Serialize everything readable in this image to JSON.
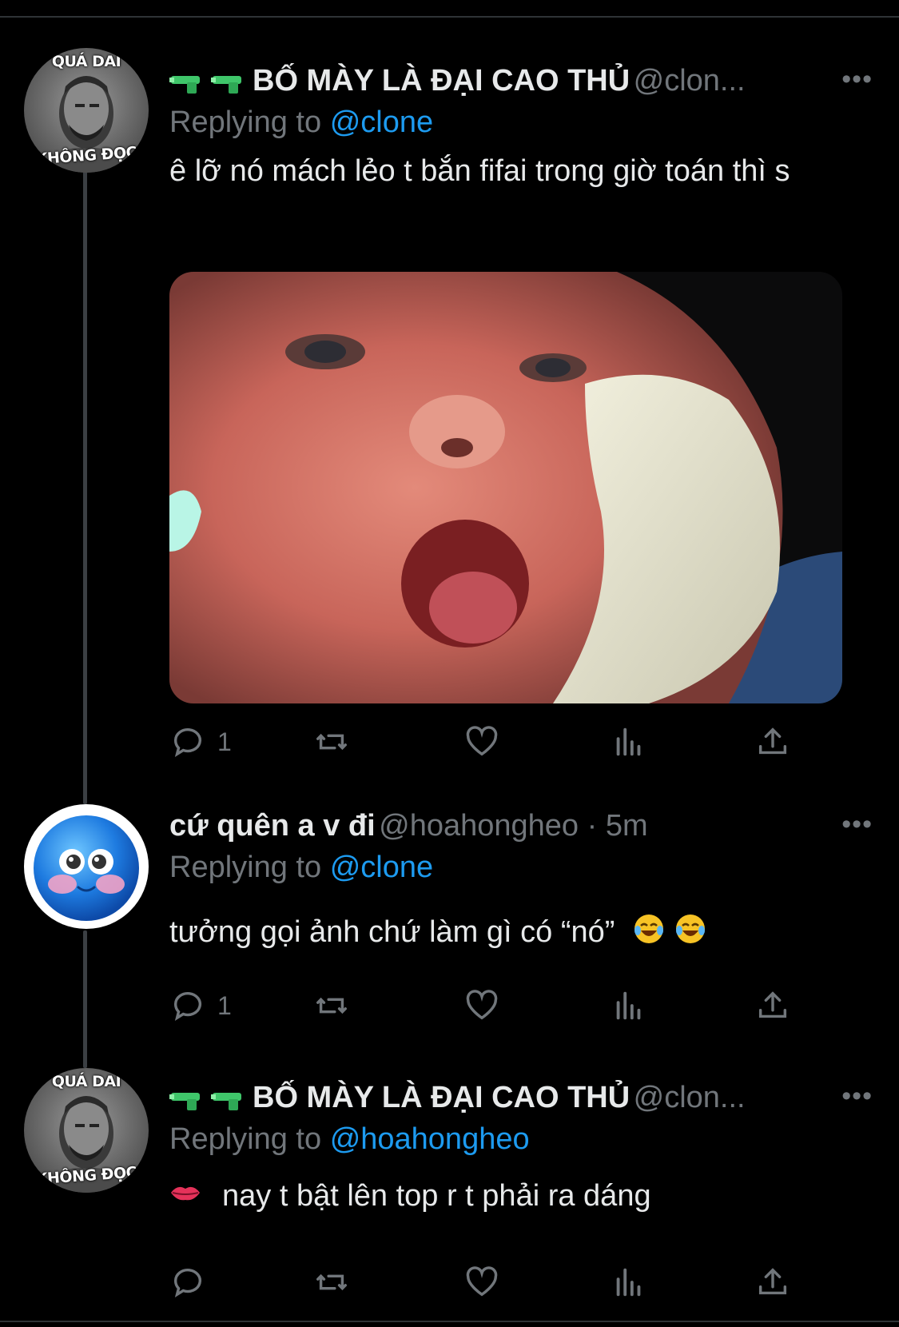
{
  "tweets": [
    {
      "display_name": "BỐ MÀY LÀ ĐẠI CAO THỦ",
      "handle": "@clon...",
      "avatar_text_top": "QUÁ DAI",
      "avatar_text_bottom": "KHÔNG ĐỌC",
      "replying_label": "Replying to",
      "replying_to": "@clone",
      "text": "ê lỡ nó mách lẻo t bắn fifai trong giờ toán thì s",
      "reply_count": "1",
      "more_label": "•••"
    },
    {
      "display_name": "cứ quên a v đi",
      "handle": "@hoahongheo · 5m",
      "replying_label": "Replying to",
      "replying_to": "@clone",
      "text": "tưởng gọi ảnh chứ làm gì có “nó”",
      "reply_count": "1",
      "more_label": "•••"
    },
    {
      "display_name": "BỐ MÀY LÀ ĐẠI CAO THỦ",
      "handle": "@clon...",
      "avatar_text_top": "QUÁ DAI",
      "avatar_text_bottom": "KHÔNG ĐỌC",
      "replying_label": "Replying to",
      "replying_to": "@hoahongheo",
      "text": "nay t bật lên top r t phải ra dáng",
      "reply_count": "",
      "more_label": "•••"
    }
  ],
  "colors": {
    "background": "#000000",
    "text": "#e7e9ea",
    "muted": "#71767b",
    "link": "#1d9bf0",
    "thread_line": "#3b3f43"
  },
  "icons": [
    "water-pistol-icon",
    "reply-icon",
    "retweet-icon",
    "like-icon",
    "views-icon",
    "share-icon",
    "lips-icon",
    "laughing-emoji-icon",
    "more-icon"
  ]
}
